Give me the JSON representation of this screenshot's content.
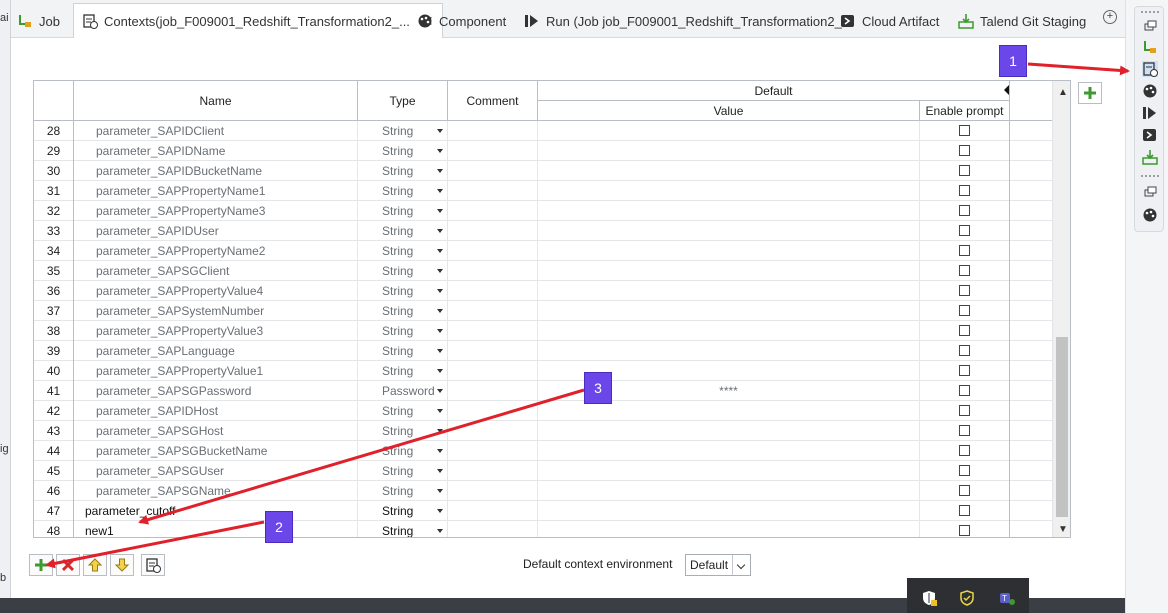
{
  "tabs": [
    {
      "label": "Job",
      "icon": "job-icon"
    },
    {
      "label": "Contexts(job_F009001_Redshift_Transformation2_...",
      "icon": "contexts-icon",
      "active": true
    },
    {
      "label": "Component",
      "icon": "component-icon"
    },
    {
      "label": "Run (Job job_F009001_Redshift_Transformation2_...",
      "icon": "run-icon"
    },
    {
      "label": "Cloud Artifact",
      "icon": "cloud-artifact-icon"
    },
    {
      "label": "Talend Git Staging",
      "icon": "git-staging-icon"
    }
  ],
  "table": {
    "headers": {
      "name": "Name",
      "type": "Type",
      "comment": "Comment",
      "default": "Default",
      "value": "Value",
      "enable_prompt": "Enable prompt"
    },
    "rows": [
      {
        "num": "28",
        "name": "parameter_SAPIDClient",
        "type": "String",
        "value": ""
      },
      {
        "num": "29",
        "name": "parameter_SAPIDName",
        "type": "String",
        "value": ""
      },
      {
        "num": "30",
        "name": "parameter_SAPIDBucketName",
        "type": "String",
        "value": ""
      },
      {
        "num": "31",
        "name": "parameter_SAPPropertyName1",
        "type": "String",
        "value": ""
      },
      {
        "num": "32",
        "name": "parameter_SAPPropertyName3",
        "type": "String",
        "value": ""
      },
      {
        "num": "33",
        "name": "parameter_SAPIDUser",
        "type": "String",
        "value": ""
      },
      {
        "num": "34",
        "name": "parameter_SAPPropertyName2",
        "type": "String",
        "value": ""
      },
      {
        "num": "35",
        "name": "parameter_SAPSGClient",
        "type": "String",
        "value": ""
      },
      {
        "num": "36",
        "name": "parameter_SAPPropertyValue4",
        "type": "String",
        "value": ""
      },
      {
        "num": "37",
        "name": "parameter_SAPSystemNumber",
        "type": "String",
        "value": ""
      },
      {
        "num": "38",
        "name": "parameter_SAPPropertyValue3",
        "type": "String",
        "value": ""
      },
      {
        "num": "39",
        "name": "parameter_SAPLanguage",
        "type": "String",
        "value": ""
      },
      {
        "num": "40",
        "name": "parameter_SAPPropertyValue1",
        "type": "String",
        "value": ""
      },
      {
        "num": "41",
        "name": "parameter_SAPSGPassword",
        "type": "Password",
        "value": "****"
      },
      {
        "num": "42",
        "name": "parameter_SAPIDHost",
        "type": "String",
        "value": ""
      },
      {
        "num": "43",
        "name": "parameter_SAPSGHost",
        "type": "String",
        "value": ""
      },
      {
        "num": "44",
        "name": "parameter_SAPSGBucketName",
        "type": "String",
        "value": ""
      },
      {
        "num": "45",
        "name": "parameter_SAPSGUser",
        "type": "String",
        "value": ""
      },
      {
        "num": "46",
        "name": "parameter_SAPSGName",
        "type": "String",
        "value": ""
      },
      {
        "num": "47",
        "name": "parameter_cutoff",
        "type": "String",
        "value": "",
        "active": true
      },
      {
        "num": "48",
        "name": "new1",
        "type": "String",
        "value": "",
        "active": true
      }
    ]
  },
  "bottom": {
    "default_context_label": "Default context environment",
    "default_context_value": "Default"
  },
  "annotations": [
    "1",
    "2",
    "3"
  ],
  "left_fragments": [
    "ai",
    "ig",
    "b"
  ],
  "colors": {
    "callout": "#6b46e8",
    "arrow": "#e0202a",
    "add_green": "#3c9a2f",
    "remove_red": "#d62a2a"
  }
}
